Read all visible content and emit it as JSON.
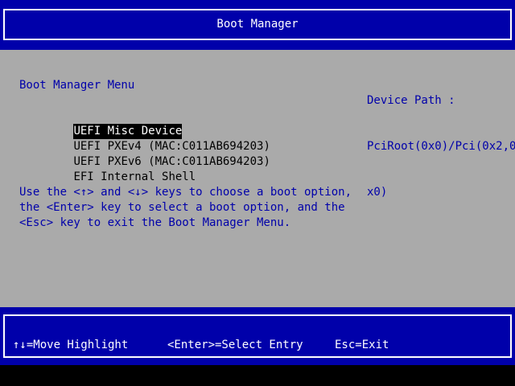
{
  "header": {
    "title": "Boot Manager"
  },
  "main": {
    "menu_title": "Boot Manager Menu",
    "device_path": {
      "label": "Device Path :",
      "value_line1": "PciRoot(0x0)/Pci(0x2,0",
      "value_line2": "x0)"
    },
    "boot_options": [
      {
        "label": "UEFI Misc Device",
        "selected": true
      },
      {
        "label": "UEFI PXEv4 (MAC:C011AB694203)",
        "selected": false
      },
      {
        "label": "UEFI PXEv6 (MAC:C011AB694203)",
        "selected": false
      },
      {
        "label": "EFI Internal Shell",
        "selected": false
      }
    ],
    "help_lines": [
      "Use the <↑> and <↓> keys to choose a boot option,",
      "the <Enter> key to select a boot option, and the",
      "<Esc> key to exit the Boot Manager Menu."
    ]
  },
  "footer": {
    "move": "↑↓=Move Highlight",
    "select": "<Enter>=Select Entry",
    "exit": "Esc=Exit"
  },
  "colors": {
    "bios_blue": "#0000aa",
    "bios_gray": "#aaaaaa",
    "highlight_bg": "#000000",
    "highlight_fg": "#ffffff",
    "border": "#ffffff"
  }
}
